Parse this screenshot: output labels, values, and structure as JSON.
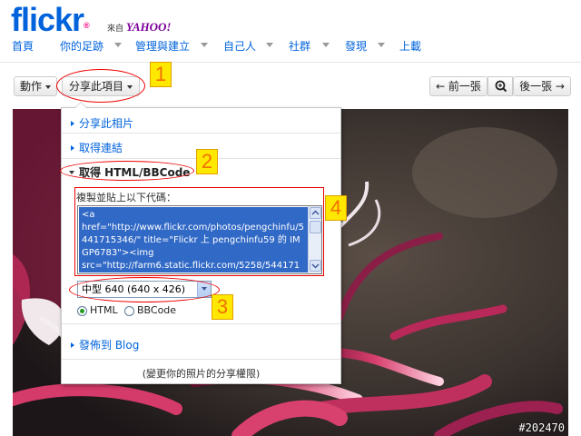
{
  "header": {
    "logo": {
      "part1": "flickr",
      "registered": "®"
    },
    "yahoo_prefix": "來自",
    "yahoo_brand": "YAHOO!",
    "nav": [
      "首頁",
      "你的足跡",
      "管理與建立",
      "自己人",
      "社群",
      "發現",
      "上載"
    ]
  },
  "toolbar": {
    "actions_label": "動作",
    "share_label": "分享此項目",
    "prev_label": "← 前一張",
    "next_label": "後一張 →"
  },
  "share_panel": {
    "share_photo": "分享此相片",
    "get_link": "取得連結",
    "get_html": "取得 HTML/BBCode",
    "copy_instruction": "複製並貼上以下代碼：",
    "code_text": "<a\nhref=\"http://www.flickr.com/photos/pengchinfu/5441715346/\" title=\"Flickr 上 pengchinfu59 的 IMGP6783\"><img\nsrc=\"http://farm6.static.flickr.com/5258/544171",
    "size_selected": "中型 640 (640 x 426)",
    "format_html": "HTML",
    "format_bbcode": "BBCode",
    "blog": "發佈到 Blog",
    "privacy": "(變更你的照片的分享權限)"
  },
  "annotations": [
    "1",
    "2",
    "3",
    "4"
  ],
  "watermark": "#202470",
  "colors": {
    "flickr_blue": "#0063dc",
    "flickr_pink": "#ff0084",
    "annotation_red": "#ee0000",
    "selection_blue": "#3169c6"
  }
}
